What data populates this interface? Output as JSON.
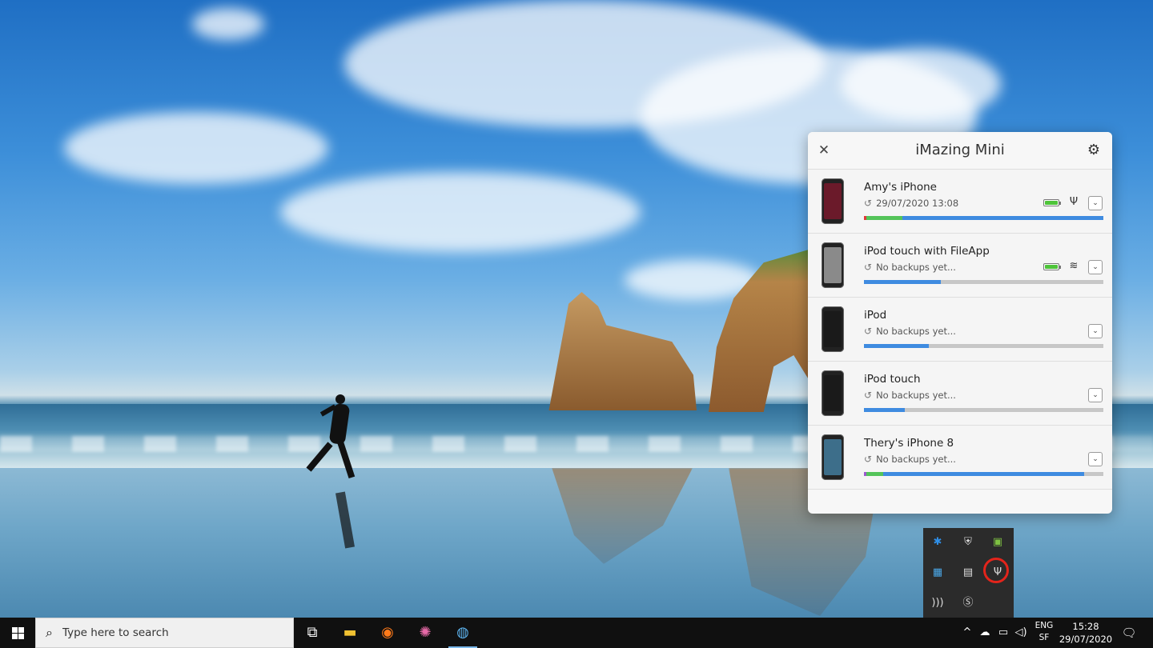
{
  "panel": {
    "title": "iMazing Mini",
    "close_icon": "close-icon",
    "settings_icon": "gear-icon"
  },
  "devices": [
    {
      "name": "Amy's iPhone",
      "backup": "29/07/2020 13:08",
      "connection": "usb",
      "battery_percent": 100,
      "storage": [
        {
          "color": "#e03a3a",
          "pct": 1
        },
        {
          "color": "#54c45a",
          "pct": 15
        },
        {
          "color": "#3f8be0",
          "pct": 84
        }
      ],
      "screen_color": "#6b1a2a"
    },
    {
      "name": "iPod touch with FileApp",
      "backup": "No backups yet...",
      "connection": "wifi",
      "battery_percent": 100,
      "storage": [
        {
          "color": "#3f8be0",
          "pct": 32
        }
      ],
      "screen_color": "#8a8a8a"
    },
    {
      "name": "iPod",
      "backup": "No backups yet...",
      "connection": "",
      "battery_percent": null,
      "storage": [
        {
          "color": "#3f8be0",
          "pct": 27
        }
      ],
      "screen_color": "#1a1a1a"
    },
    {
      "name": "iPod touch",
      "backup": "No backups yet...",
      "connection": "",
      "battery_percent": null,
      "storage": [
        {
          "color": "#3f8be0",
          "pct": 17
        }
      ],
      "screen_color": "#1a1a1a"
    },
    {
      "name": "Thery's iPhone 8",
      "backup": "No backups yet...",
      "connection": "",
      "battery_percent": null,
      "storage": [
        {
          "color": "#9b59d0",
          "pct": 1
        },
        {
          "color": "#54c45a",
          "pct": 7
        },
        {
          "color": "#3f8be0",
          "pct": 84
        }
      ],
      "screen_color": "#3d6e8a"
    }
  ],
  "taskbar": {
    "search_placeholder": "Type here to search",
    "lang_top": "ENG",
    "lang_bottom": "SF",
    "time": "15:28",
    "date": "29/07/2020"
  },
  "colors": {
    "accent_blue": "#3f8be0",
    "battery_green": "#4ec43a",
    "highlight_red": "#e3241b"
  }
}
